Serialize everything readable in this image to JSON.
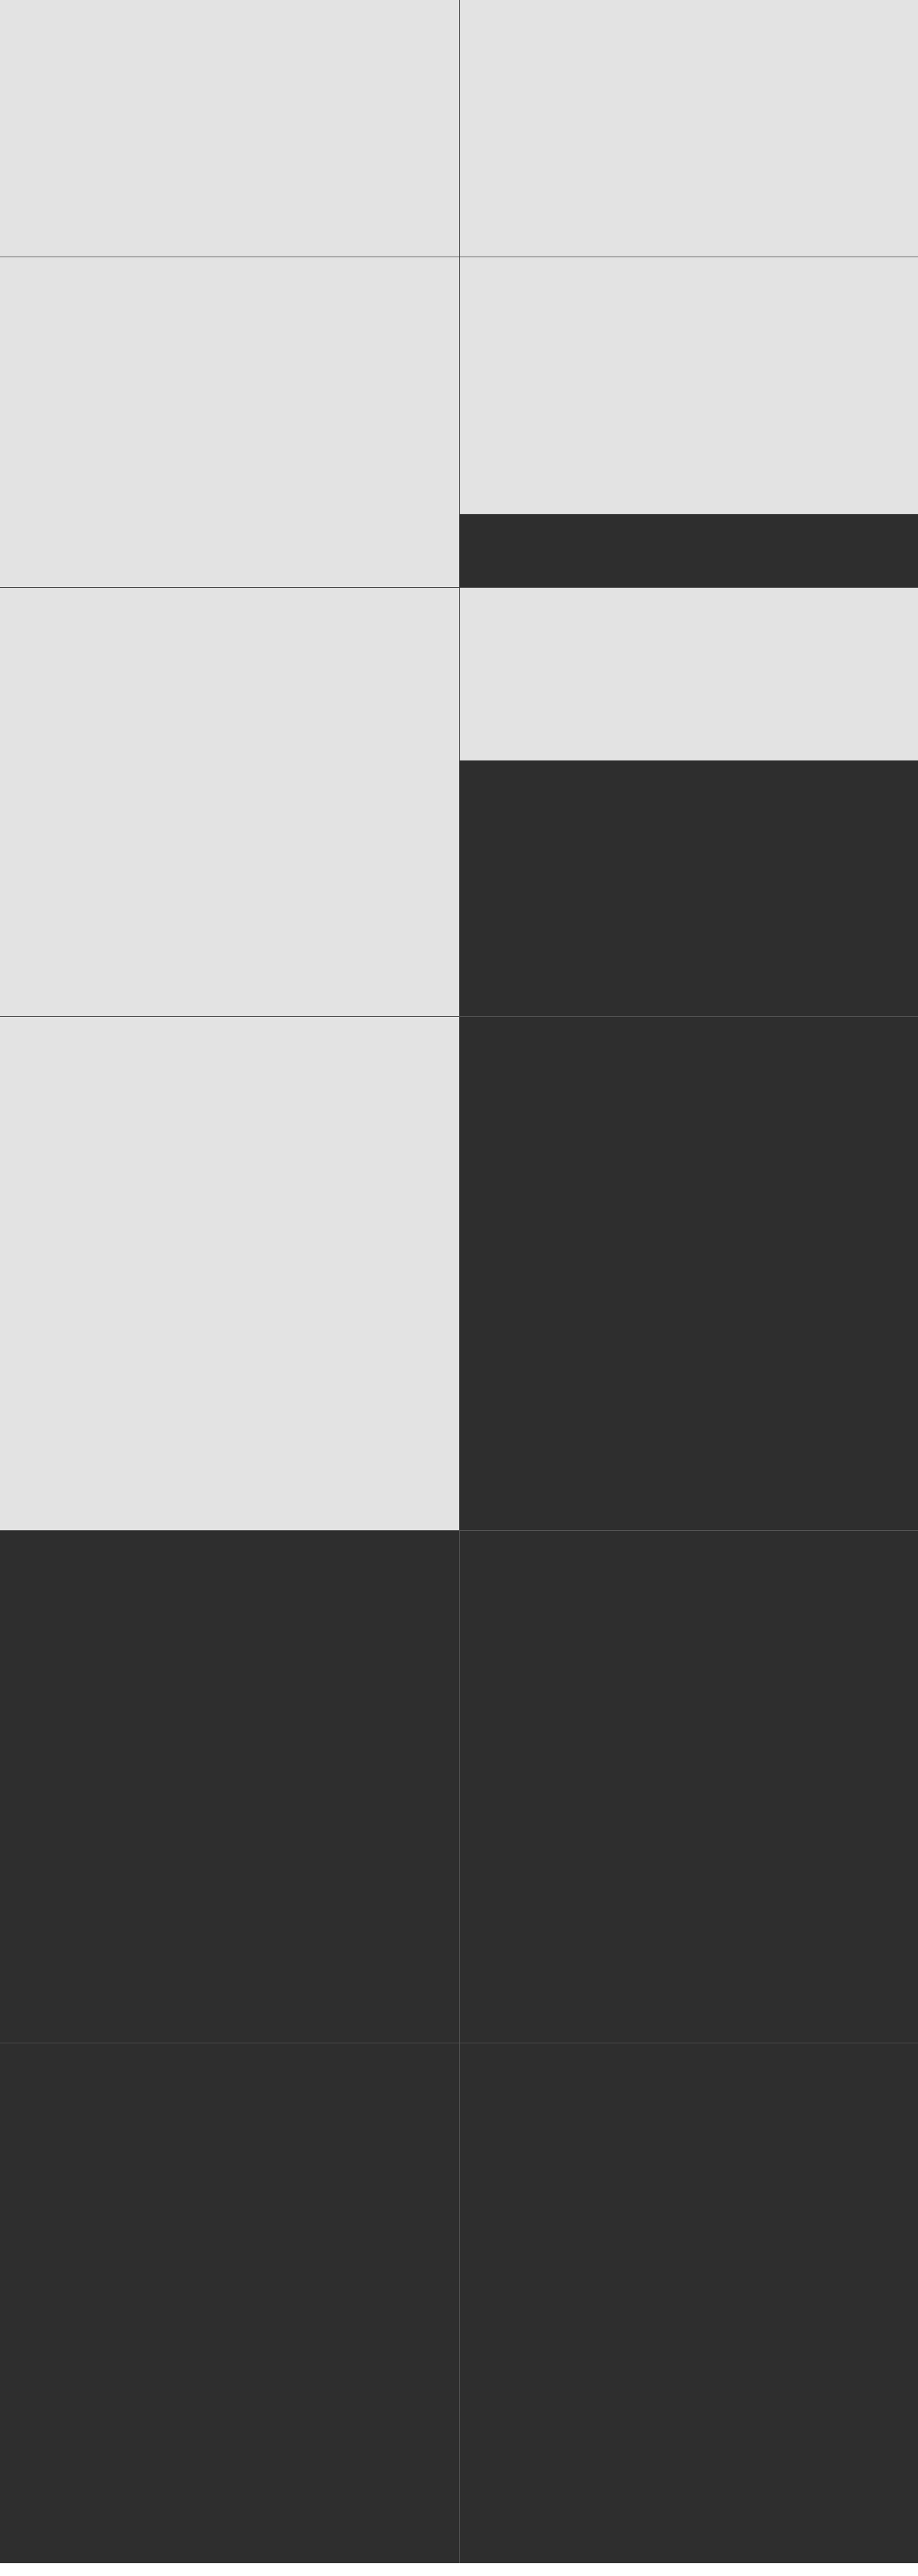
{
  "colors": {
    "light_tile": "#e3e3e3",
    "dark_tile": "#2e2e2e",
    "light_divider": "#3f3f3f",
    "dark_divider": "#555555",
    "page_background": "#ffffff"
  },
  "tiles": [
    {
      "id": "tile-r1-left",
      "shade": "light"
    },
    {
      "id": "tile-r1-right",
      "shade": "light"
    },
    {
      "id": "tile-r2-left-tall",
      "shade": "light"
    },
    {
      "id": "tile-r2-right-top",
      "shade": "light"
    },
    {
      "id": "tile-r2-right-bottom",
      "shade": "dark"
    },
    {
      "id": "tile-r3-left-tall",
      "shade": "light"
    },
    {
      "id": "tile-r3-right-top",
      "shade": "light"
    },
    {
      "id": "tile-r3-right-bottom",
      "shade": "dark"
    },
    {
      "id": "tile-r4-left",
      "shade": "light"
    },
    {
      "id": "tile-r4-right",
      "shade": "dark"
    },
    {
      "id": "tile-r5-left",
      "shade": "dark"
    },
    {
      "id": "tile-r5-right",
      "shade": "dark"
    },
    {
      "id": "tile-r6-left",
      "shade": "dark"
    },
    {
      "id": "tile-r6-right",
      "shade": "dark"
    }
  ]
}
